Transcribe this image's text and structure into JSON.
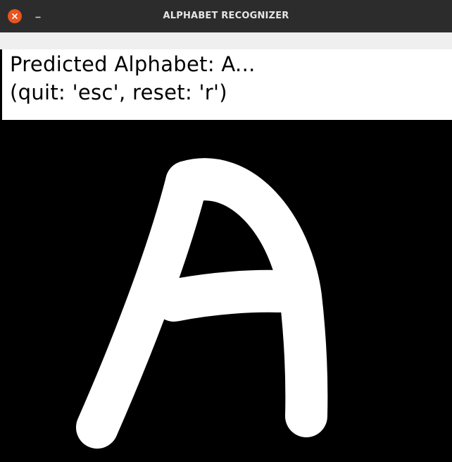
{
  "window": {
    "title": "ALPHABET RECOGNIZER",
    "close_icon": "close-icon",
    "minimize_icon": "minimize-icon",
    "accent_color": "#e95420"
  },
  "banner": {
    "prediction": "Predicted Alphabet: A...",
    "help": "(quit: 'esc', reset: 'r')"
  },
  "canvas": {
    "background": "#000000",
    "stroke_color": "#ffffff",
    "drawn_letter": "A"
  }
}
